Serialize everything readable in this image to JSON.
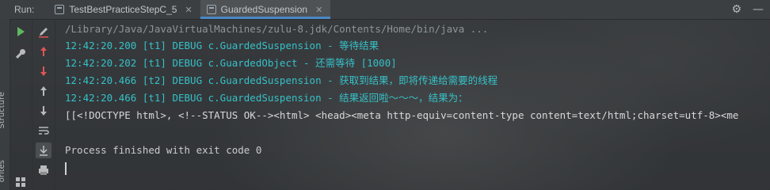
{
  "run_label": "Run:",
  "tabs": [
    {
      "label": "TestBestPracticeStepC_5",
      "active": false
    },
    {
      "label": "GuardedSuspension",
      "active": true
    }
  ],
  "side_labels": [
    "Structure",
    "orites"
  ],
  "console": {
    "command_line": "/Library/Java/JavaVirtualMachines/zulu-8.jdk/Contents/Home/bin/java ...",
    "log_lines": [
      "12:42:20.200 [t1] DEBUG c.GuardedSuspension - 等待结果",
      "12:42:20.202 [t1] DEBUG c.GuardedObject - 还需等待 [1000]",
      "12:42:20.466 [t2] DEBUG c.GuardedSuspension - 获取到结果，即将传递给需要的线程",
      "12:42:20.466 [t1] DEBUG c.GuardedSuspension - 结果返回啦～～～，结果为："
    ],
    "output_line": " [[<!DOCTYPE html>, <!--STATUS OK--><html> <head><meta http-equiv=content-type content=text/html;charset=utf-8><me",
    "finish_line": "Process finished with exit code 0"
  },
  "colors": {
    "log_text": "#35c1c8",
    "accent": "#4a88c7",
    "run_green": "#5fb85f",
    "stop_red": "#e05555"
  },
  "icons": {
    "toolbar1": [
      "play-icon",
      "wrench-icon",
      "layout-icon",
      "pin-icon"
    ],
    "toolbar2": [
      "edit-icon",
      "rerun-up-icon",
      "rerun-down-icon",
      "arrow-up-icon",
      "arrow-down-icon",
      "soft-wrap-icon",
      "scroll-to-end-icon",
      "print-icon"
    ],
    "top_right": [
      "gear-icon",
      "minimize-icon"
    ]
  }
}
